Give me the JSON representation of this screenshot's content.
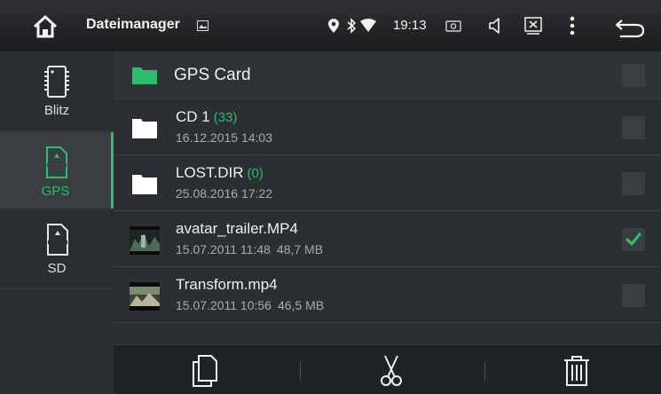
{
  "status_bar": {
    "title": "Dateimanager",
    "time": "19:13",
    "icons": [
      "home-icon",
      "image-notification-icon",
      "location-icon",
      "bluetooth-icon",
      "wifi-icon",
      "screenshot-icon",
      "volume-icon",
      "close-window-icon",
      "overflow-menu-icon",
      "back-icon"
    ]
  },
  "sidebar": {
    "items": [
      {
        "label": "Blitz",
        "icon": "flash-memory-icon",
        "selected": false
      },
      {
        "label": "GPS",
        "icon": "sd-card-icon",
        "selected": true
      },
      {
        "label": "SD",
        "icon": "sd-card-icon",
        "selected": false
      }
    ]
  },
  "main": {
    "current_folder": "GPS Card",
    "rows": [
      {
        "name": "CD 1",
        "count": "(33)",
        "date": "16.12.2015 14:03",
        "size": "",
        "type": "folder",
        "checked": false
      },
      {
        "name": "LOST.DIR",
        "count": "(0)",
        "date": "25.08.2016 17:22",
        "size": "",
        "type": "folder",
        "checked": false
      },
      {
        "name": "avatar_trailer.MP4",
        "count": "",
        "date": "15.07.2011 11:48",
        "size": "48,7 MB",
        "type": "video",
        "checked": true
      },
      {
        "name": "Transform.mp4",
        "count": "",
        "date": "15.07.2011 10:56",
        "size": "46,5 MB",
        "type": "video",
        "checked": false
      }
    ]
  },
  "toolbar": {
    "icons": [
      "copy-icon",
      "cut-icon",
      "delete-icon"
    ]
  },
  "colors": {
    "accent": "#2ebd6e",
    "background": "#2b2e32",
    "sidebar": "#2a2d31",
    "selected": "#3a3d41"
  }
}
